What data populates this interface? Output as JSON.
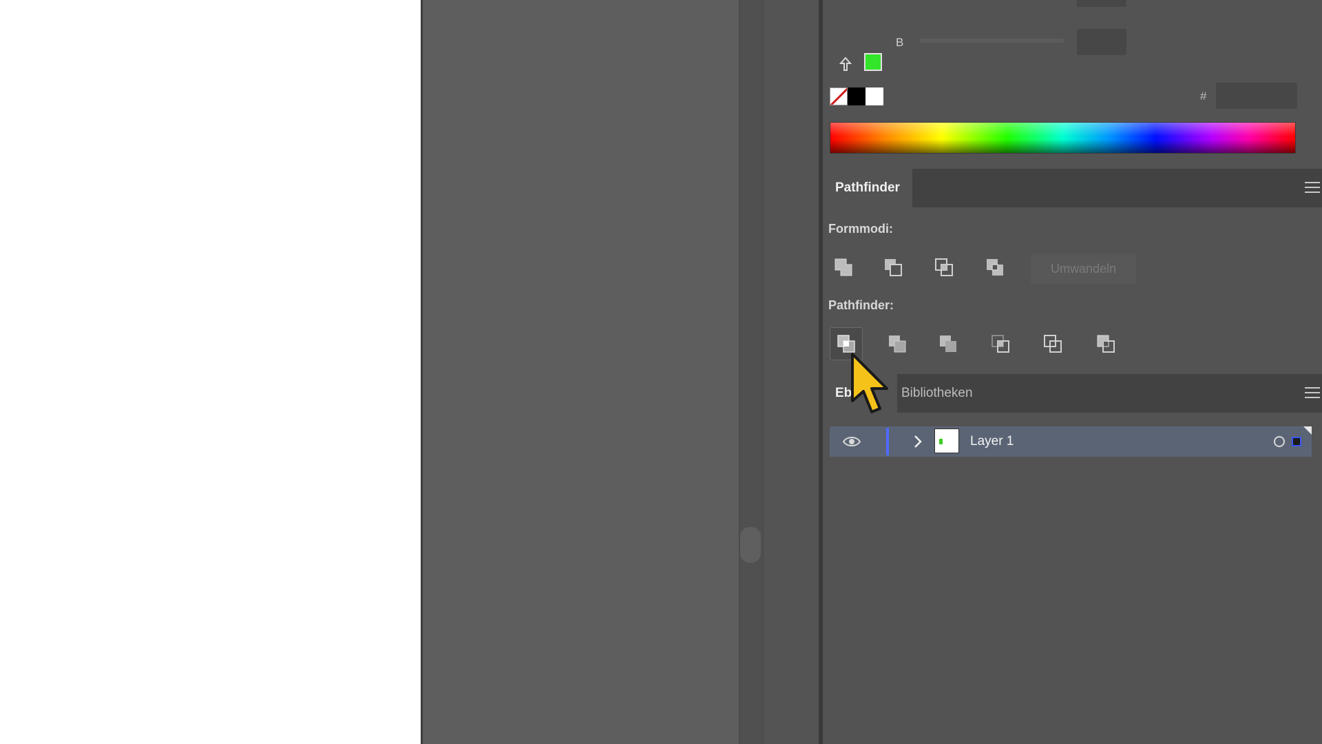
{
  "colors": {
    "current_fill": "#33e52a",
    "layer_color": "#4f6bff",
    "selection_row": "#5b6475"
  },
  "color_panel": {
    "channel_label": "B",
    "hex_label": "#",
    "hex_value": ""
  },
  "pathfinder_panel": {
    "tab_label": "Pathfinder",
    "shape_modes_label": "Formmodi:",
    "shape_mode_buttons": [
      "unite-icon",
      "minus-front-icon",
      "intersect-icon",
      "exclude-icon"
    ],
    "convert_label": "Umwandeln",
    "pathfinders_label": "Pathfinder:",
    "pathfinder_buttons": [
      "divide-icon",
      "trim-icon",
      "merge-icon",
      "crop-icon",
      "outline-icon",
      "minus-back-icon"
    ],
    "selected_button": "divide-icon"
  },
  "layers_panel": {
    "tab_layers_label": "Ebe",
    "tab_libraries_label": "Bibliotheken",
    "layers": [
      {
        "name": "Layer 1",
        "visible": true,
        "expanded": false
      }
    ]
  }
}
